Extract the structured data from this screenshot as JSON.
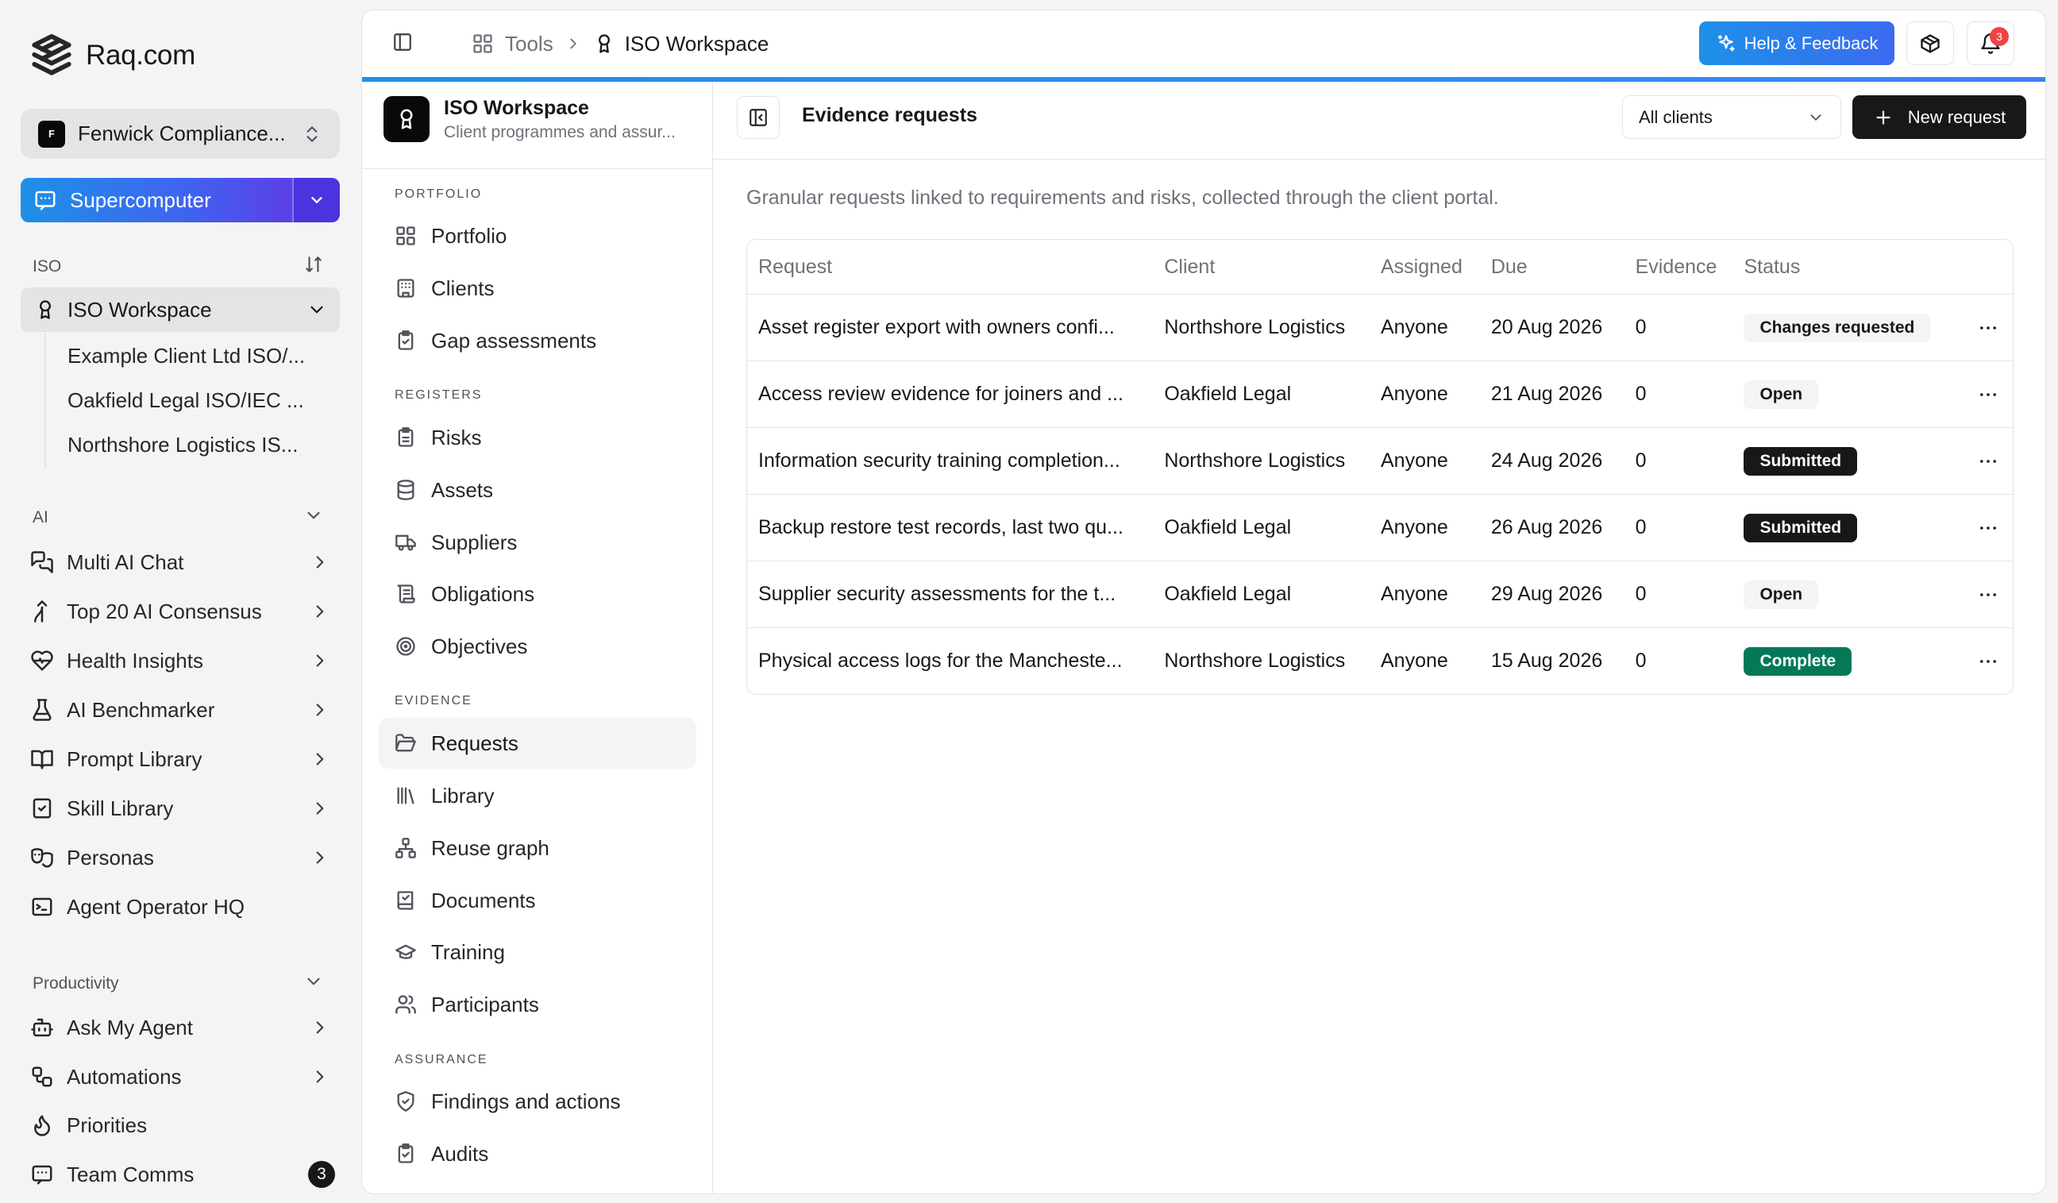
{
  "app": {
    "brand": "Raq.com"
  },
  "org": {
    "badge": "F",
    "name": "Fenwick Compliance..."
  },
  "supercomputer": {
    "label": "Supercomputer"
  },
  "sidebar": {
    "iso_label": "ISO",
    "workspace": {
      "label": "ISO Workspace",
      "children": [
        "Example Client Ltd ISO/...",
        "Oakfield Legal ISO/IEC ...",
        "Northshore Logistics IS..."
      ]
    },
    "ai_label": "AI",
    "ai_items": [
      {
        "label": "Multi AI Chat",
        "icon": "chat-bubbles-icon"
      },
      {
        "label": "Top 20 AI Consensus",
        "icon": "merge-icon"
      },
      {
        "label": "Health Insights",
        "icon": "heart-pulse-icon"
      },
      {
        "label": "AI Benchmarker",
        "icon": "flask-icon"
      },
      {
        "label": "Prompt Library",
        "icon": "book-open-icon"
      },
      {
        "label": "Skill Library",
        "icon": "clipboard-check-icon"
      },
      {
        "label": "Personas",
        "icon": "masks-icon"
      },
      {
        "label": "Agent Operator HQ",
        "icon": "terminal-icon"
      }
    ],
    "productivity_label": "Productivity",
    "productivity_items": [
      {
        "label": "Ask My Agent",
        "icon": "bot-icon"
      },
      {
        "label": "Automations",
        "icon": "workflow-icon"
      },
      {
        "label": "Priorities",
        "icon": "flame-icon"
      },
      {
        "label": "Team Comms",
        "icon": "message-square-icon",
        "count": "3"
      }
    ]
  },
  "topbar": {
    "crumb_tools": "Tools",
    "crumb_current": "ISO Workspace",
    "help_label": "Help & Feedback",
    "notif_count": "3"
  },
  "inner_nav": {
    "title": "ISO Workspace",
    "subtitle": "Client programmes and assur...",
    "groups": {
      "portfolio": "PORTFOLIO",
      "registers": "REGISTERS",
      "evidence": "EVIDENCE",
      "assurance": "ASSURANCE"
    },
    "items": {
      "portfolio": "Portfolio",
      "clients": "Clients",
      "gap": "Gap assessments",
      "risks": "Risks",
      "assets": "Assets",
      "suppliers": "Suppliers",
      "obligations": "Obligations",
      "objectives": "Objectives",
      "requests": "Requests",
      "library": "Library",
      "reuse": "Reuse graph",
      "documents": "Documents",
      "training": "Training",
      "participants": "Participants",
      "findings": "Findings and actions",
      "audits": "Audits"
    }
  },
  "content": {
    "title": "Evidence requests",
    "client_filter": "All clients",
    "new_request": "New request",
    "description": "Granular requests linked to requirements and risks, collected through the client portal.",
    "columns": [
      "Request",
      "Client",
      "Assigned",
      "Due",
      "Evidence",
      "Status"
    ],
    "rows": [
      {
        "request": "Asset register export with owners confi...",
        "client": "Northshore Logistics",
        "assigned": "Anyone",
        "due": "20 Aug 2026",
        "evidence": "0",
        "status": "Changes requested"
      },
      {
        "request": "Access review evidence for joiners and ...",
        "client": "Oakfield Legal",
        "assigned": "Anyone",
        "due": "21 Aug 2026",
        "evidence": "0",
        "status": "Open"
      },
      {
        "request": "Information security training completion...",
        "client": "Northshore Logistics",
        "assigned": "Anyone",
        "due": "24 Aug 2026",
        "evidence": "0",
        "status": "Submitted"
      },
      {
        "request": "Backup restore test records, last two qu...",
        "client": "Oakfield Legal",
        "assigned": "Anyone",
        "due": "26 Aug 2026",
        "evidence": "0",
        "status": "Submitted"
      },
      {
        "request": "Supplier security assessments for the t...",
        "client": "Oakfield Legal",
        "assigned": "Anyone",
        "due": "29 Aug 2026",
        "evidence": "0",
        "status": "Open"
      },
      {
        "request": "Physical access logs for the Mancheste...",
        "client": "Northshore Logistics",
        "assigned": "Anyone",
        "due": "15 Aug 2026",
        "evidence": "0",
        "status": "Complete"
      }
    ]
  },
  "colors": {
    "accent_gradient_start": "#1e90e8",
    "accent_gradient_end": "#5b3fe6",
    "status_complete": "#047857",
    "status_submitted": "#18181b",
    "notification": "#ef4444"
  }
}
